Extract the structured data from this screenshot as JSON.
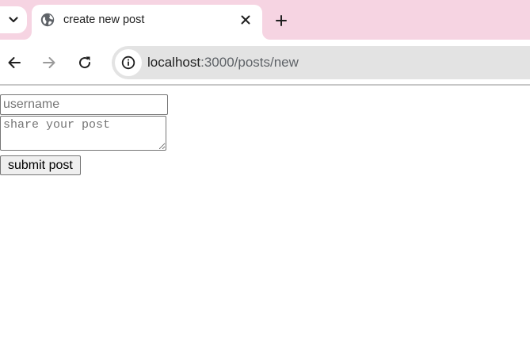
{
  "browser": {
    "tab": {
      "title": "create new post",
      "favicon": "globe-icon"
    },
    "tabstrip_color": "#f6d4e2",
    "omnibox": {
      "host": "localhost",
      "path": ":3000/posts/new"
    }
  },
  "page": {
    "form": {
      "username_placeholder": "username",
      "username_value": "",
      "post_placeholder": "share your post",
      "post_value": "",
      "submit_label": "submit post"
    }
  }
}
